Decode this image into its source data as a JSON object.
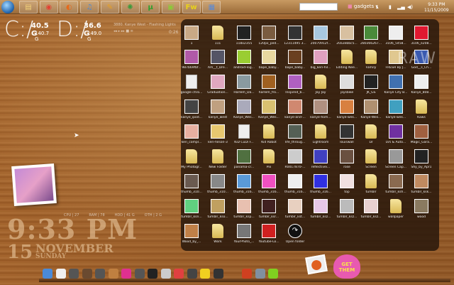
{
  "taskbar": {
    "apps": [
      {
        "name": "explorer",
        "color": "#f3d27a",
        "glyph": "▤"
      },
      {
        "name": "chrome",
        "color": "#e34133",
        "glyph": "◉"
      },
      {
        "name": "firefox",
        "color": "#e66a1c",
        "glyph": "◐"
      },
      {
        "name": "itunes",
        "color": "#4a8ad8",
        "glyph": "♫"
      },
      {
        "name": "app-pen",
        "color": "#e8a020",
        "glyph": "✎"
      },
      {
        "name": "app-green",
        "color": "#3a9a3a",
        "glyph": "✺"
      },
      {
        "name": "utorrent",
        "color": "#2ca02c",
        "glyph": "µ"
      },
      {
        "name": "app-lime",
        "color": "#8cc83a",
        "glyph": "▣"
      },
      {
        "name": "fireworks",
        "color": "#e8d21a",
        "glyph": "Fw"
      },
      {
        "name": "app-blue",
        "color": "#5a8ad8",
        "glyph": "▦"
      }
    ],
    "gadgets_label": "gadgets",
    "time": "9:33 PM",
    "date": "11/15/2009"
  },
  "drives": [
    {
      "letter": "C:/",
      "free": "40.5 G",
      "total": "140.7 G"
    },
    {
      "letter": "D:/",
      "free": "36.6 G",
      "total": "149.0 G"
    }
  ],
  "music": {
    "track": "3880. Kanye West - Flashing Lights",
    "controls": "◂◂ ▸ ▸▸ ■ ≡",
    "elapsed": "0:26"
  },
  "watermark": "RAW",
  "folder_items": [
    {
      "label": "1",
      "kind": "image",
      "color": "#c9a986"
    },
    {
      "label": "111",
      "kind": "folder"
    },
    {
      "label": "118x2355",
      "kind": "image",
      "color": "#222"
    },
    {
      "label": "120px_ped...",
      "kind": "image",
      "color": "#7a5c40"
    },
    {
      "label": "12311495 3...",
      "kind": "image",
      "color": "#333"
    },
    {
      "label": "20070912f...",
      "kind": "image",
      "color": "#a8c8e0"
    },
    {
      "label": "20a3ebbc5...",
      "kind": "image",
      "color": "#d8c0a0"
    },
    {
      "label": "280366267...",
      "kind": "image",
      "color": "#4a8a3a"
    },
    {
      "label": "3106_5458...",
      "kind": "image",
      "color": "#eee"
    },
    {
      "label": "3106_e208...",
      "kind": "image",
      "color": "#e01830"
    },
    {
      "label": "987b69fbf...",
      "kind": "image",
      "color": "#b05aa8"
    },
    {
      "label": "Am__t_Dre...",
      "kind": "image",
      "color": "#556"
    },
    {
      "label": "android-log...",
      "kind": "image",
      "color": "#9acd32"
    },
    {
      "label": "bape_baby...",
      "kind": "image",
      "color": "#e8d8a0"
    },
    {
      "label": "bape_baby...",
      "kind": "image",
      "color": "#6a4020"
    },
    {
      "label": "big_keri-hil...",
      "kind": "image",
      "color": "#e0a0c0"
    },
    {
      "label": "Editing Nee...",
      "kind": "folder"
    },
    {
      "label": "Family",
      "kind": "folder"
    },
    {
      "label": "FRESH By J...",
      "kind": "image",
      "color": "#e0c890"
    },
    {
      "label": "God__s_Ch...",
      "kind": "image",
      "color": "#3a5ab0"
    },
    {
      "label": "google chro...",
      "kind": "file"
    },
    {
      "label": "Graduation...",
      "kind": "image",
      "color": "#e0a8c0"
    },
    {
      "label": "Harlem_Da...",
      "kind": "image",
      "color": "#8a9aa0"
    },
    {
      "label": "harlem_fro...",
      "kind": "image",
      "color": "#a06020"
    },
    {
      "label": "Inspired_b...",
      "kind": "image",
      "color": "#b060c0"
    },
    {
      "label": "Jay Jay",
      "kind": "folder"
    },
    {
      "label": "jaysbike",
      "kind": "image",
      "color": "#ddd"
    },
    {
      "label": "JK_GS",
      "kind": "image",
      "color": "#222"
    },
    {
      "label": "Kanye City B...",
      "kind": "image",
      "color": "#4070b0"
    },
    {
      "label": "Kanye_808...",
      "kind": "image",
      "color": "#eee"
    },
    {
      "label": "kanye_ipod...",
      "kind": "image",
      "color": "#444"
    },
    {
      "label": "kanye_west",
      "kind": "image",
      "color": "#c0a080"
    },
    {
      "label": "Kanye_Wes...",
      "kind": "image",
      "color": "#aab"
    },
    {
      "label": "Kanye_Wes...",
      "kind": "image",
      "color": "#d8c070"
    },
    {
      "label": "kanye-and-...",
      "kind": "image",
      "color": "#d08870"
    },
    {
      "label": "kanye-hom...",
      "kind": "image",
      "color": "#b09080"
    },
    {
      "label": "kanye-wes...",
      "kind": "image",
      "color": "#d88040"
    },
    {
      "label": "Kanye-Wes...",
      "kind": "image",
      "color": "#b09070"
    },
    {
      "label": "kanye-wes...",
      "kind": "image",
      "color": "#40a0c0"
    },
    {
      "label": "Kaws",
      "kind": "folder"
    },
    {
      "label": "keri_compl...",
      "kind": "image",
      "color": "#e8b0a0"
    },
    {
      "label": "keri-hilson-3",
      "kind": "image",
      "color": "#e8c870"
    },
    {
      "label": "KiD CuDi F...",
      "kind": "file"
    },
    {
      "label": "Kid Robot",
      "kind": "folder"
    },
    {
      "label": "life_throug...",
      "kind": "image",
      "color": "#556055"
    },
    {
      "label": "Lightroom",
      "kind": "folder"
    },
    {
      "label": "louiswall",
      "kind": "image",
      "color": "#333"
    },
    {
      "label": "LV",
      "kind": "folder"
    },
    {
      "label": "LVs & Auto...",
      "kind": "image",
      "color": "#7030a0"
    },
    {
      "label": "Magic_Gara...",
      "kind": "image",
      "color": "#a06040"
    },
    {
      "label": "My Photogr...",
      "kind": "folder"
    },
    {
      "label": "New Folder",
      "kind": "folder"
    },
    {
      "label": "panama-cr...",
      "kind": "image",
      "color": "#507040"
    },
    {
      "label": "Pix",
      "kind": "folder"
    },
    {
      "label": "R0017870-...",
      "kind": "image",
      "color": "#ccc"
    },
    {
      "label": "reflectivei...",
      "kind": "image",
      "color": "#4040c0"
    },
    {
      "label": "rose",
      "kind": "image",
      "color": "#6a5040"
    },
    {
      "label": "Screen",
      "kind": "folder"
    },
    {
      "label": "Screen Cap...",
      "kind": "image",
      "color": "#999"
    },
    {
      "label": "Shy_by_Apr1",
      "kind": "image",
      "color": "#222"
    },
    {
      "label": "thumb_310...",
      "kind": "image",
      "color": "#6a5a50"
    },
    {
      "label": "thumb_310...",
      "kind": "image",
      "color": "#888"
    },
    {
      "label": "thumb_316...",
      "kind": "image",
      "color": "#5a9ad8"
    },
    {
      "label": "thumb_316...",
      "kind": "image",
      "color": "#f050c0"
    },
    {
      "label": "thumb_316...",
      "kind": "image",
      "color": "#eee"
    },
    {
      "label": "thumb_316...",
      "kind": "image",
      "color": "#3030e0"
    },
    {
      "label": "top",
      "kind": "image",
      "color": "#f0e0e0"
    },
    {
      "label": "tumblr",
      "kind": "folder"
    },
    {
      "label": "tumblr_ksh...",
      "kind": "image",
      "color": "#8a6a50"
    },
    {
      "label": "tumblr_ksk...",
      "kind": "image",
      "color": "#c08a60"
    },
    {
      "label": "tumblr_ksn...",
      "kind": "image",
      "color": "#60d080"
    },
    {
      "label": "tumblr_kso...",
      "kind": "image",
      "color": "#c0a060"
    },
    {
      "label": "tumblr_ksp...",
      "kind": "image",
      "color": "#e8c0b0"
    },
    {
      "label": "tumblr_ksr...",
      "kind": "image",
      "color": "#402020"
    },
    {
      "label": "tumblr_kst...",
      "kind": "image",
      "color": "#e8d0c0"
    },
    {
      "label": "tumblr_ksz...",
      "kind": "image",
      "color": "#e8c8e8"
    },
    {
      "label": "tumblr_ksz...",
      "kind": "image",
      "color": "#bbb"
    },
    {
      "label": "tumblr_ksz...",
      "kind": "image",
      "color": "#e8d0d0"
    },
    {
      "label": "wallpaper",
      "kind": "folder"
    },
    {
      "label": "wood",
      "kind": "image",
      "color": "#8a7a60"
    },
    {
      "label": "Wood_by_...",
      "kind": "image",
      "color": "#c08048"
    },
    {
      "label": "Work",
      "kind": "folder"
    },
    {
      "label": "YourPhoto_...",
      "kind": "image",
      "color": "#777"
    },
    {
      "label": "Youtube-Lo...",
      "kind": "image",
      "color": "#d02020"
    },
    {
      "label": "Open folder",
      "kind": "open"
    }
  ],
  "system": {
    "cpu": "CPU | 27",
    "ram": "RAM | 78",
    "hdd": "HDD | 41 G",
    "other": "OTH | 2 G"
  },
  "desktop_clock": {
    "time": "9:33 PM",
    "day": "15",
    "month": "NOVEMBER",
    "weekday": "SUNDAY"
  },
  "dock": {
    "colors": [
      "#4a8ad8",
      "#f0f0f0",
      "#555",
      "#6a4a30",
      "#555",
      "#c08040",
      "#e03090",
      "#555",
      "#222",
      "#ccc",
      "#e04040",
      "#444",
      "#f0d020",
      "#333",
      "#d04020",
      "#8090a0",
      "#80d020"
    ],
    "heart_text": "GET THEM"
  }
}
